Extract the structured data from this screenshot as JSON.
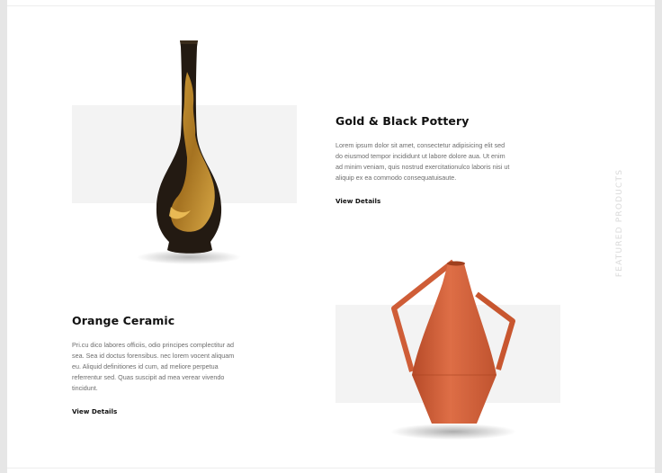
{
  "section": {
    "side_label": "FEATURED PRODUCTS"
  },
  "products": [
    {
      "title": "Gold & Black Pottery",
      "description": "Lorem ipsum dolor sit amet, consectetur adipisicing elit sed do eiusmod tempor incididunt ut labore dolore aua. Ut enim ad minim veniam, quis nostrud exercitationulco laboris nisi ut aliquip ex ea commodo consequatuisaute.",
      "link_label": "View Details"
    },
    {
      "title": "Orange Ceramic",
      "description": "Pri.cu dico labores officiis, odio principes complectitur ad sea. Sea id doctus forensibus. nec lorem vocent aliquam eu. Aliquid definitiones id cum, ad meliore perpetua referrentur sed. Quas suscipit ad mea verear vivendo tincidunt.",
      "link_label": "View Details"
    }
  ],
  "colors": {
    "block_grey": "#f3f3f3",
    "vase_gold": "#c9932c",
    "vase_black": "#231a12",
    "vase_orange": "#d2603a"
  }
}
